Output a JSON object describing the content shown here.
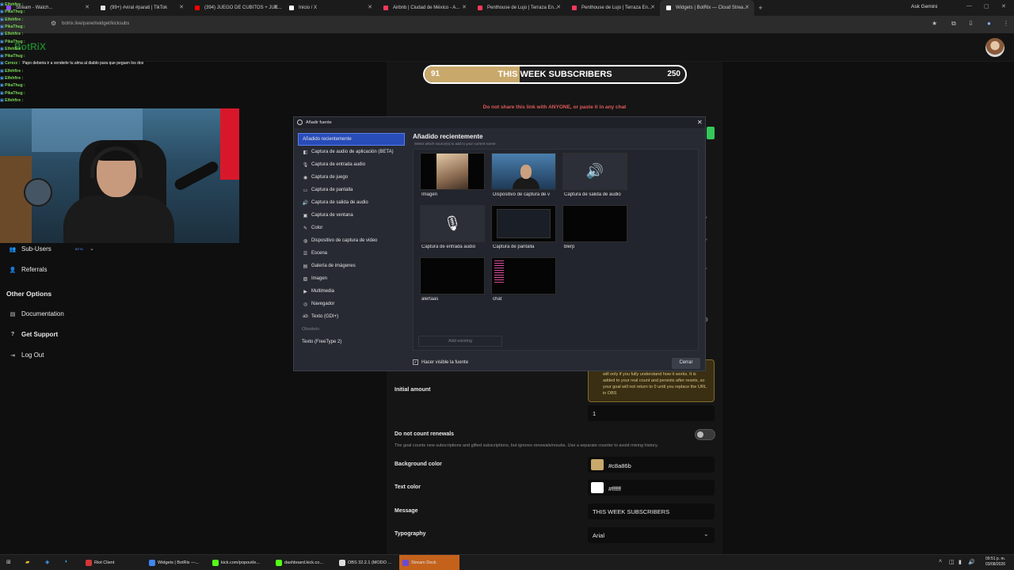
{
  "browser": {
    "tabs": [
      {
        "label": "Stream - Watch...",
        "color": "#9146ff",
        "active": false
      },
      {
        "label": "(99+) #viral #parati | TikTok",
        "color": "#e0e0e0",
        "active": false
      },
      {
        "label": "(394) JUEGO DE CUBITOS + JUE...",
        "color": "#ff0000",
        "active": false
      },
      {
        "label": "Inicio / X",
        "color": "#ffffff",
        "active": false
      },
      {
        "label": "Airbnb | Ciudad de México - A...",
        "color": "#ff385c",
        "active": false
      },
      {
        "label": "Penthouse de Lujo | Terraza En...",
        "color": "#ff385c",
        "active": false
      },
      {
        "label": "Penthouse de Lujo | Terraza En...",
        "color": "#ff385c",
        "active": false
      },
      {
        "label": "Widgets | BotRix — Cloud Strea...",
        "color": "#ffffff",
        "active": true
      }
    ],
    "new_tab": "+",
    "ask_gemini": "Ask Gemini",
    "url": "botrix.live/panel/widget/kicksubs"
  },
  "goal_widget": {
    "current": "91",
    "message": "THIS WEEK SUBSCRIBERS",
    "target": "250",
    "progress_fraction": 0.364,
    "fill_color": "#c8a86b"
  },
  "warning": "Do not share this link with ANYONE, or paste it in any chat",
  "chat_overlay": {
    "lines": [
      {
        "user": "Elfehfire :",
        "text": ""
      },
      {
        "user": "PikaThug :",
        "text": ""
      },
      {
        "user": "Elfehfire :",
        "text": ""
      },
      {
        "user": "PikaThug :",
        "text": ""
      },
      {
        "user": "Elfehfire :",
        "text": ""
      },
      {
        "user": "PikaThug :",
        "text": ""
      },
      {
        "user": "Elfehfire :",
        "text": ""
      },
      {
        "user": "PikaThug :",
        "text": ""
      },
      {
        "user": "Cerezz :",
        "text": "Papo deberia ir a venderle tu alma al diablo para que peguen los dos"
      },
      {
        "user": "Elfehfire :",
        "text": ""
      },
      {
        "user": "Elfehfire :",
        "text": ""
      },
      {
        "user": "PikaThug :",
        "text": ""
      },
      {
        "user": "PikaThug :",
        "text": ""
      },
      {
        "user": "Elfehfire :",
        "text": ""
      }
    ],
    "watermark": "BotRiX"
  },
  "sidebar": {
    "sub_users": "Sub-Users",
    "sub_users_badge": "BETA",
    "referrals": "Referrals",
    "other_options": "Other Options",
    "documentation": "Documentation",
    "get_support": "Get Support",
    "log_out": "Log Out"
  },
  "dialog": {
    "title": "Añadir fuente",
    "close": "✕",
    "sources": [
      {
        "label": "Añadido recientemente",
        "icon": "",
        "selected": true
      },
      {
        "label": "Captura de audio de aplicación (BETA)",
        "icon": "◧"
      },
      {
        "label": "Captura de entrada audio",
        "icon": "🎙"
      },
      {
        "label": "Captura de juego",
        "icon": "◉"
      },
      {
        "label": "Captura de pantalla",
        "icon": "▭"
      },
      {
        "label": "Captura de salida de audio",
        "icon": "🔊"
      },
      {
        "label": "Captura de ventana",
        "icon": "▣"
      },
      {
        "label": "Color",
        "icon": "✎"
      },
      {
        "label": "Dispositivo de captura de video",
        "icon": "◍"
      },
      {
        "label": "Escena",
        "icon": "☰"
      },
      {
        "label": "Galería de imágenes",
        "icon": "▤"
      },
      {
        "label": "Imagen",
        "icon": "▨"
      },
      {
        "label": "Multimedia",
        "icon": "▶"
      },
      {
        "label": "Navegador",
        "icon": "◎"
      },
      {
        "label": "Texto (GDI+)",
        "icon": "ab"
      }
    ],
    "obsolete_label": "Obsoleto",
    "obsolete_item": "Texto (FreeType 2)",
    "recent_title": "Añadido recientemente",
    "recent_subtitle": "Select which source(s) to add to your current scene.",
    "tiles": [
      {
        "label": "Imagen",
        "kind": "imagen"
      },
      {
        "label": "Dispositivo de captura de v",
        "kind": "camera"
      },
      {
        "label": "Captura de salida de audio",
        "kind": "speaker"
      },
      {
        "label": "Captura de entrada audio",
        "kind": "mic"
      },
      {
        "label": "Captura de pantalla",
        "kind": "screen"
      },
      {
        "label": "blerp",
        "kind": "black"
      },
      {
        "label": "alertaas",
        "kind": "black"
      },
      {
        "label": "chat",
        "kind": "chat"
      }
    ],
    "add_existing": "Add existing",
    "visible_checkbox": "Hacer visible la fuente",
    "close_button": "Cerrar"
  },
  "form": {
    "info_box": "will only if you fully understand how it works. It is added to your real count and persists after resets, so your goal will not return to 0 until you replace the URL in OBS",
    "initial_amount_label": "Initial amount",
    "initial_amount_value": "1",
    "renewals_label": "Do not count renewals",
    "renewals_hint": "The goal counts new subscriptions and gifted subscriptions, but ignores renewals/resubs. Use a separate counter to avoid mixing history.",
    "bg_color_label": "Background color",
    "bg_color_value": "#c8a86b",
    "text_color_label": "Text color",
    "text_color_value": "#ffffff",
    "message_label": "Message",
    "message_value": "THIS WEEK SUBSCRIBERS",
    "typography_label": "Typography",
    "typography_value": "Arial"
  },
  "taskbar": {
    "items": [
      {
        "label": "Riot Client",
        "color": "#d13639"
      },
      {
        "label": "Widgets | BotRix —...",
        "color": "#4285f4"
      },
      {
        "label": "kick.com/popout/e...",
        "color": "#53fc18"
      },
      {
        "label": "dashboard.kick.co...",
        "color": "#53fc18"
      },
      {
        "label": "OBS 32.2.1 (MODO ...",
        "color": "#dddddd"
      },
      {
        "label": "Stream Deck",
        "color": "#6a4bd6"
      }
    ],
    "time": "09:51 p. m.",
    "date": "03/08/2026"
  }
}
